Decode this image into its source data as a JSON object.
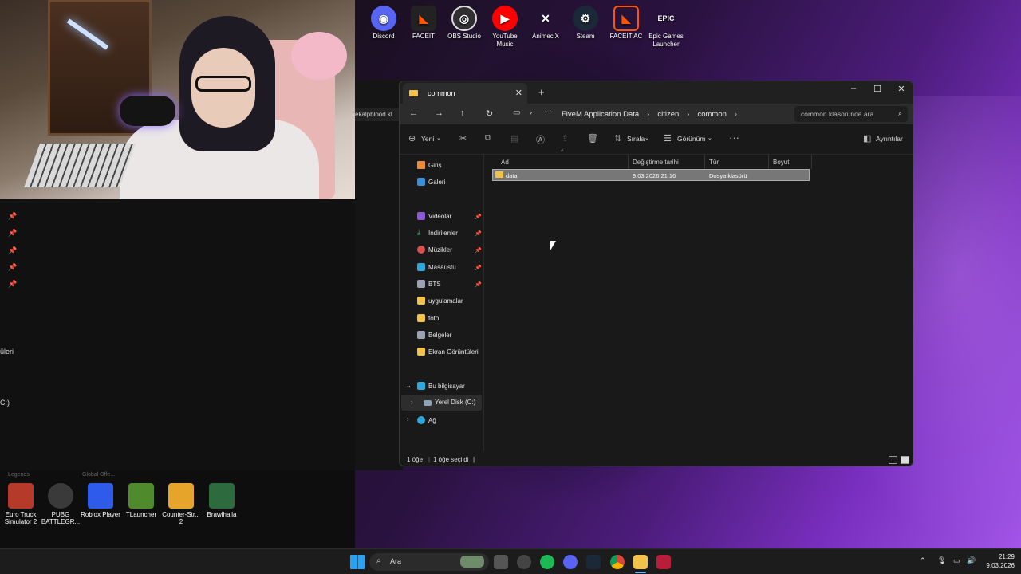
{
  "desktop_icons_top": [
    {
      "label": "Discord",
      "icon": "discord-icon",
      "color": "#5865f2"
    },
    {
      "label": "FACEIT",
      "icon": "faceit-icon",
      "color": "#ff5500"
    },
    {
      "label": "OBS Studio",
      "icon": "obs-icon",
      "color": "#302e31"
    },
    {
      "label": "YouTube Music",
      "icon": "youtube-music-icon",
      "color": "#ff0000"
    },
    {
      "label": "AnimeciX",
      "icon": "animecix-icon",
      "color": "#202020"
    },
    {
      "label": "Steam",
      "icon": "steam-icon",
      "color": "#1b2838"
    },
    {
      "label": "FACEIT AC",
      "icon": "faceit-ac-icon",
      "color": "#ff5500"
    },
    {
      "label": "Epic Games Launcher",
      "icon": "epic-games-icon",
      "color": "#111111"
    }
  ],
  "left_panel": {
    "partial_tab": "ekalpblood kl",
    "partial_item_1": "üleri",
    "partial_item_2": "C:)"
  },
  "explorer": {
    "tab_title": "common",
    "breadcrumb": [
      "FiveM Application Data",
      "citizen",
      "common"
    ],
    "search_placeholder": "common klasöründe ara",
    "toolbar": {
      "new": "Yeni",
      "sort": "Sırala",
      "view": "Görünüm",
      "details": "Ayrıntılar"
    },
    "sidebar": {
      "home": "Giriş",
      "gallery": "Galeri",
      "videos": "Videolar",
      "downloads": "İndirilenler",
      "music": "Müzikler",
      "desktop": "Masaüstü",
      "bts": "BTS",
      "apps": "uygulamalar",
      "photo": "foto",
      "documents": "Belgeler",
      "screenshots": "Ekran Görüntüleri",
      "this_pc": "Bu bilgisayar",
      "local_disk": "Yerel Disk (C:)",
      "network": "Ağ"
    },
    "columns": [
      "Ad",
      "Değiştirme tarihi",
      "Tür",
      "Boyut"
    ],
    "rows": [
      {
        "name": "data",
        "modified": "9.03.2026 21:16",
        "type": "Dosya klasörü",
        "size": ""
      }
    ],
    "status": {
      "count": "1 öğe",
      "selected": "1 öğe seçildi"
    }
  },
  "desktop_icons_bottom": [
    {
      "label": "Euro Truck Simulator 2",
      "icon": "euro-truck-icon",
      "color": "#b53a2a"
    },
    {
      "label": "PUBG BATTLEGR...",
      "icon": "pubg-icon",
      "color": "#3a3a3a"
    },
    {
      "label": "Roblox Player",
      "icon": "roblox-icon",
      "color": "#2f5bea"
    },
    {
      "label": "TLauncher",
      "icon": "tlauncher-icon",
      "color": "#4f8a2c"
    },
    {
      "label": "Counter-Str... 2",
      "icon": "counter-strike-icon",
      "color": "#e6a42a"
    },
    {
      "label": "Brawlhalla",
      "icon": "brawlhalla-icon",
      "color": "#2d6a3e"
    }
  ],
  "faded_labels": [
    "Legends",
    "Global Offe..."
  ],
  "taskbar": {
    "search": "Ara",
    "time": "21:29",
    "date": "9.03.2026"
  }
}
